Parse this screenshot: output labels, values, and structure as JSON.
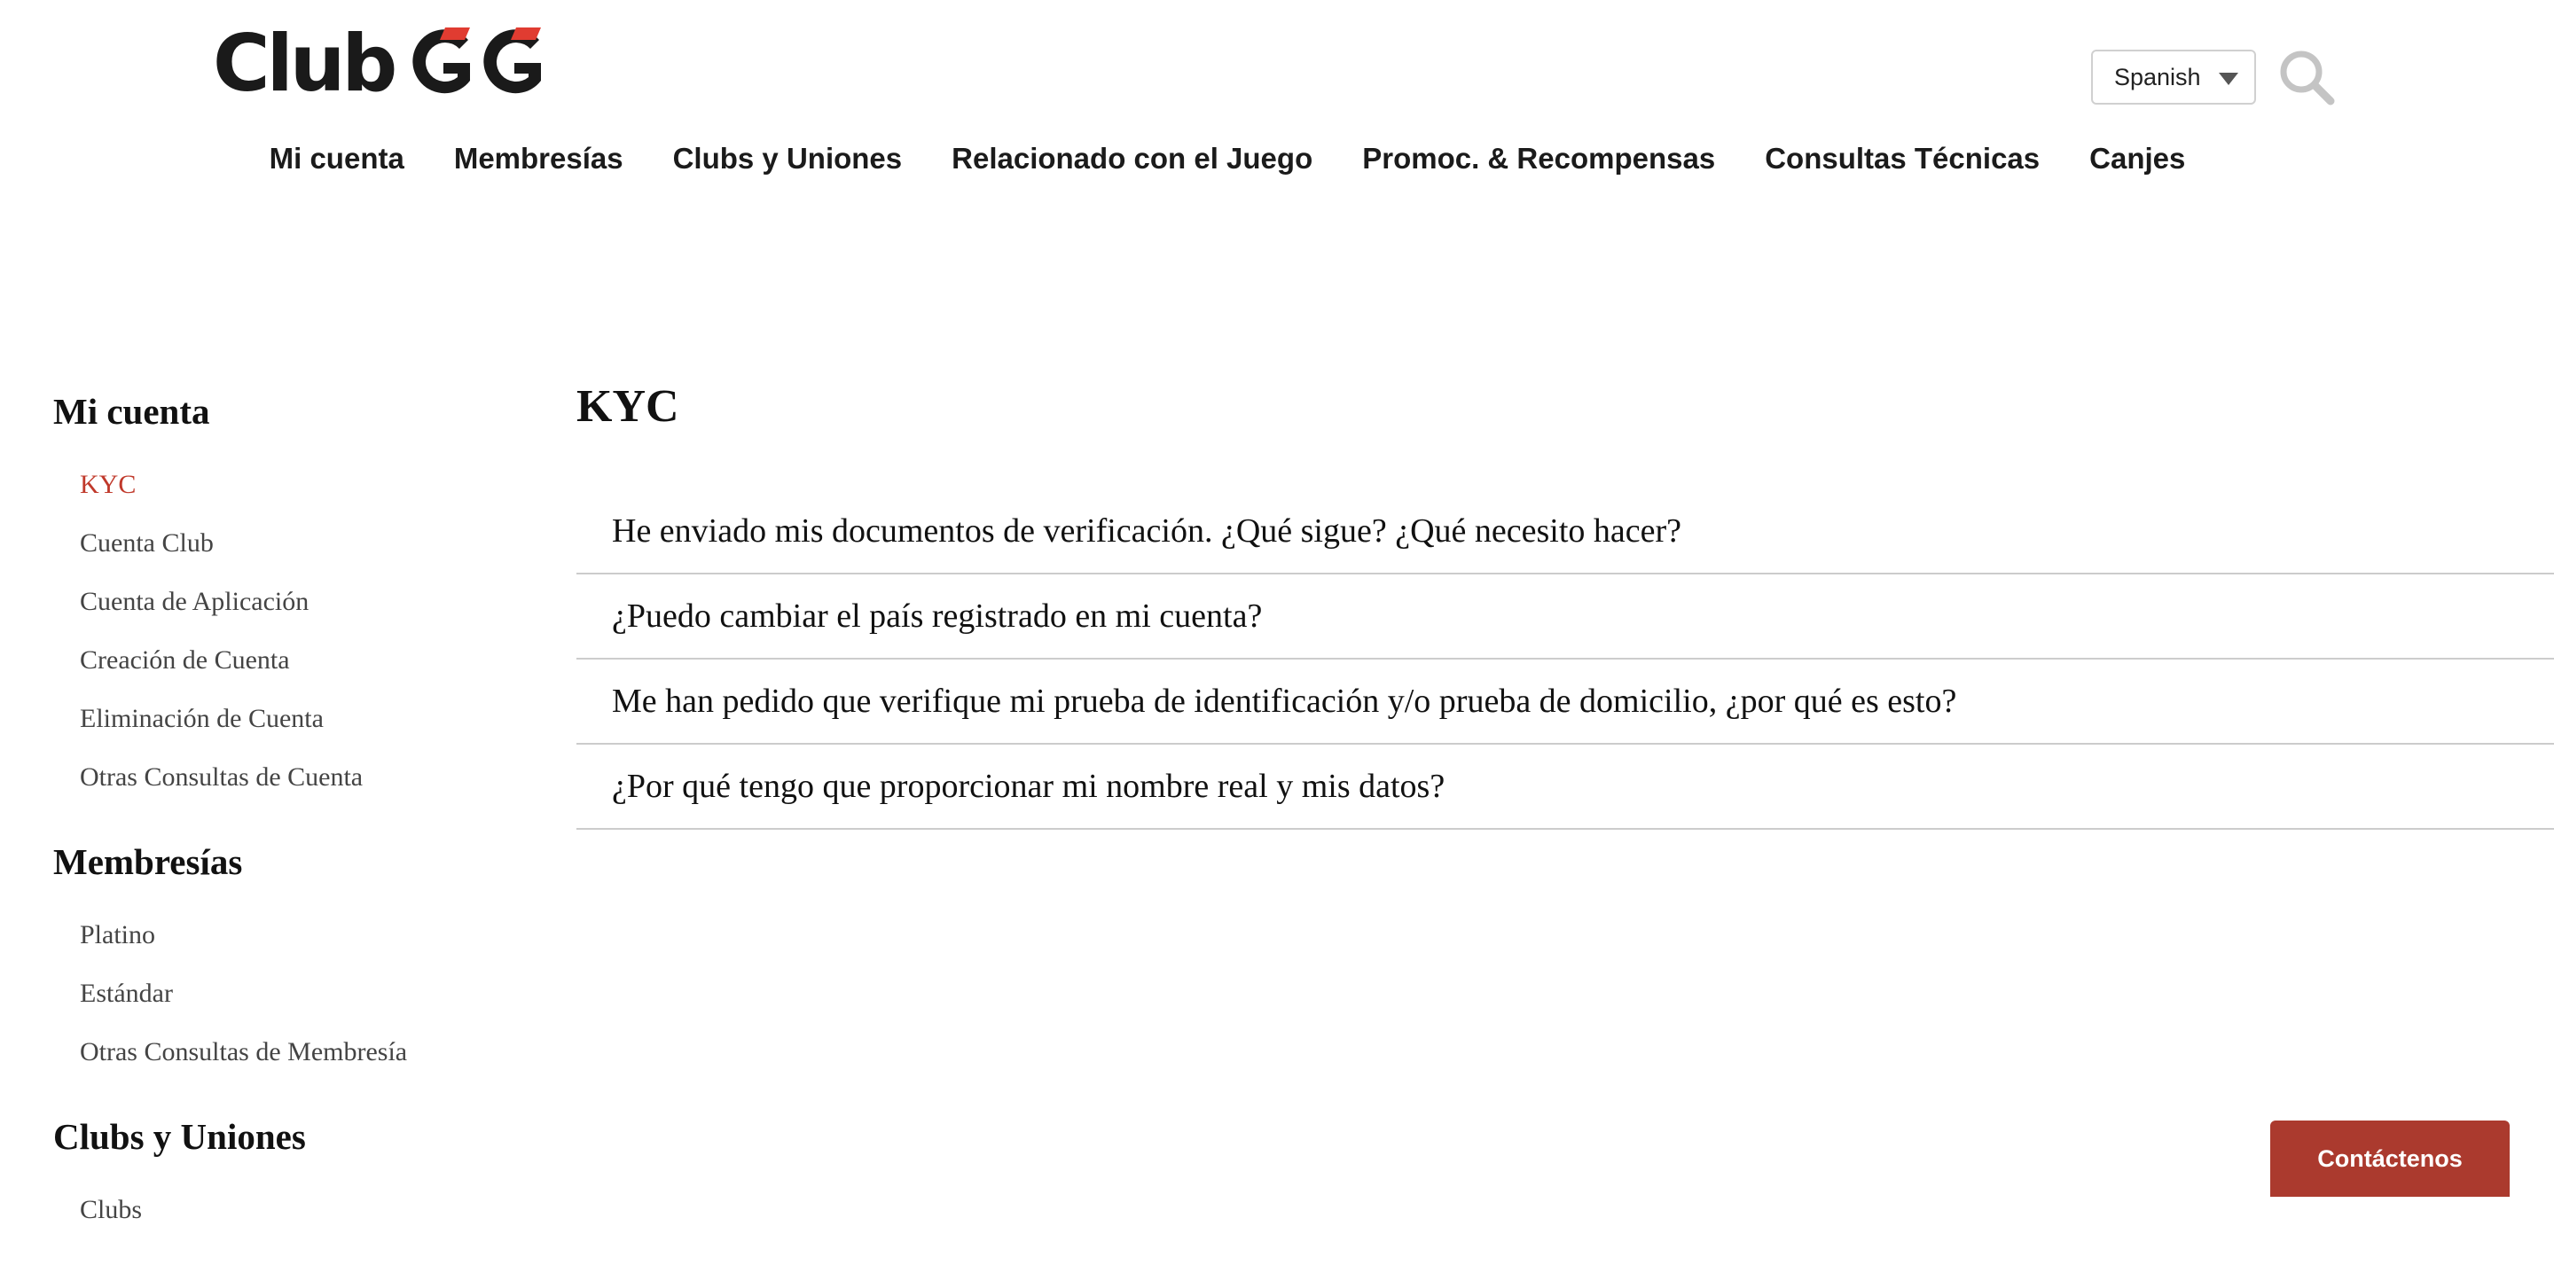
{
  "header": {
    "logo": {
      "text_club": "Club",
      "text_gg": "GG",
      "accent_color": "#e03c31"
    },
    "language_select": {
      "value": "Spanish",
      "icon": "chevron-down-icon"
    },
    "search": {
      "icon": "search-icon"
    }
  },
  "main_nav": [
    {
      "label": "Mi cuenta"
    },
    {
      "label": "Membresías"
    },
    {
      "label": "Clubs y Uniones"
    },
    {
      "label": "Relacionado con el Juego"
    },
    {
      "label": "Promoc. & Recompensas"
    },
    {
      "label": "Consultas Técnicas"
    },
    {
      "label": "Canjes"
    }
  ],
  "sidebar": {
    "sections": [
      {
        "title": "Mi cuenta",
        "items": [
          {
            "label": "KYC",
            "active": true
          },
          {
            "label": "Cuenta Club"
          },
          {
            "label": "Cuenta de Aplicación"
          },
          {
            "label": "Creación de Cuenta"
          },
          {
            "label": "Eliminación de Cuenta"
          },
          {
            "label": "Otras Consultas de Cuenta"
          }
        ]
      },
      {
        "title": "Membresías",
        "items": [
          {
            "label": "Platino"
          },
          {
            "label": "Estándar"
          },
          {
            "label": "Otras Consultas de Membresía"
          }
        ]
      },
      {
        "title": "Clubs y Uniones",
        "items": [
          {
            "label": "Clubs"
          }
        ]
      }
    ],
    "active_color": "#c0392b"
  },
  "content": {
    "title": "KYC",
    "faqs": [
      {
        "question": "He enviado mis documentos de verificación. ¿Qué sigue? ¿Qué necesito hacer?"
      },
      {
        "question": "¿Puedo cambiar el país registrado en mi cuenta?"
      },
      {
        "question": "Me han pedido que verifique mi prueba de identificación y/o prueba de domicilio, ¿por qué es esto?"
      },
      {
        "question": "¿Por qué tengo que proporcionar mi nombre real y mis datos?"
      }
    ]
  },
  "contact_button": {
    "label": "Contáctenos",
    "color": "#ab3a2e"
  }
}
